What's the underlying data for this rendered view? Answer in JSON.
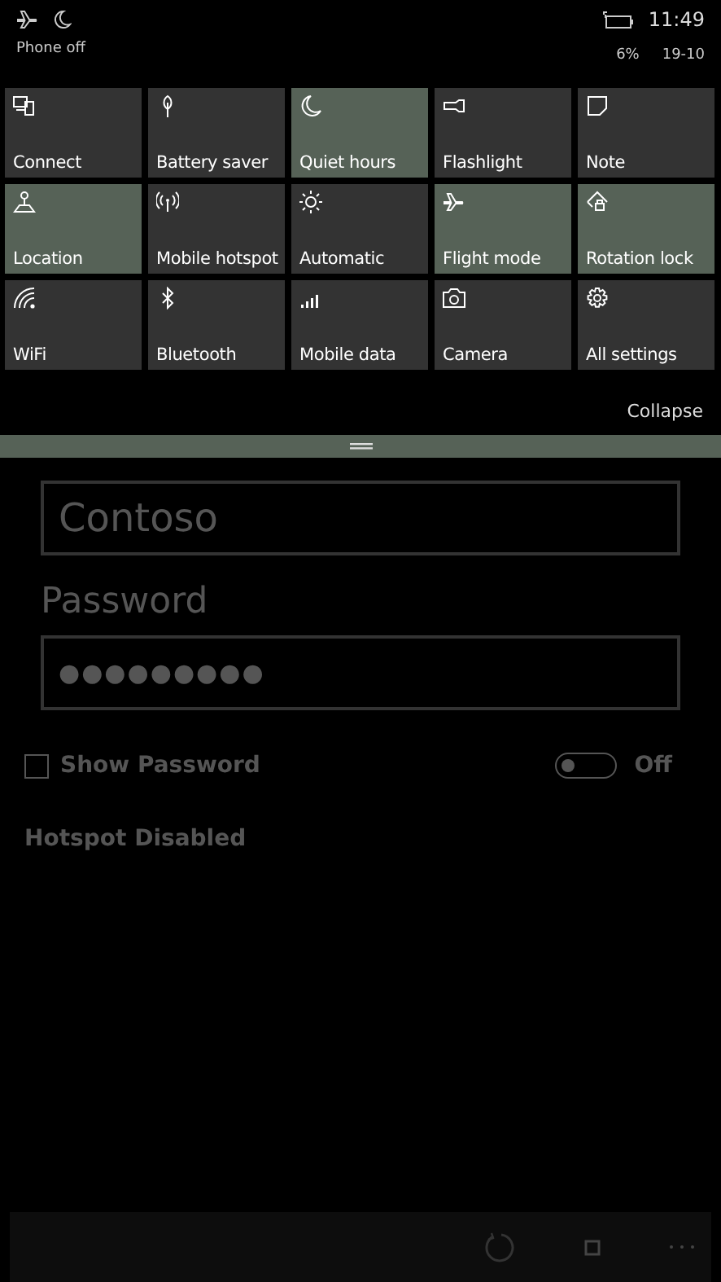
{
  "status_bar": {
    "carrier": "Phone off",
    "time": "11:49",
    "battery": "6%",
    "date": "19-10"
  },
  "quick_actions": [
    {
      "label": "Connect",
      "on": false
    },
    {
      "label": "Battery saver",
      "on": false
    },
    {
      "label": "Quiet hours",
      "on": true
    },
    {
      "label": "Flashlight",
      "on": false
    },
    {
      "label": "Note",
      "on": false
    },
    {
      "label": "Location",
      "on": true
    },
    {
      "label": "Mobile hotspot",
      "on": false
    },
    {
      "label": "Automatic",
      "on": false
    },
    {
      "label": "Flight mode",
      "on": true
    },
    {
      "label": "Rotation lock",
      "on": true
    },
    {
      "label": "WiFi",
      "on": false
    },
    {
      "label": "Bluetooth",
      "on": false
    },
    {
      "label": "Mobile data",
      "on": false
    },
    {
      "label": "Camera",
      "on": false
    },
    {
      "label": "All settings",
      "on": false
    }
  ],
  "collapse": "Collapse",
  "form": {
    "name_value": "Contoso",
    "password_label": "Password",
    "password_value": "●●●●●●●●●",
    "show_password": {
      "label": "Show Password",
      "checked": false
    },
    "toggle": {
      "label": "Off",
      "on": false
    },
    "status": "Hotspot Disabled"
  }
}
